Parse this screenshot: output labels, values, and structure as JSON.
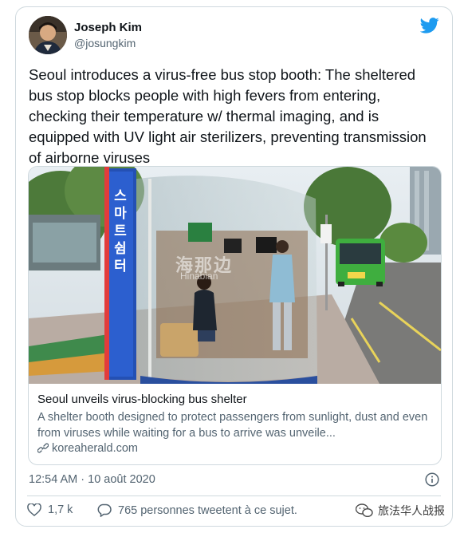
{
  "author": {
    "name": "Joseph Kim",
    "handle": "@josungkim"
  },
  "tweet": {
    "text": "Seoul introduces a virus-free bus stop booth: The sheltered bus stop blocks people with high fevers from entering, checking their temperature w/ thermal imaging, and is equipped with UV light air sterilizers, preventing transmission of airborne viruses",
    "timestamp": "12:54 AM · 10 août 2020"
  },
  "link_card": {
    "image": {
      "booth_sign": "스마트쉼터",
      "watermark_cn": "海那边",
      "watermark_en": "Hinabian",
      "bus_color": "#3fae3f"
    },
    "title": "Seoul unveils virus-blocking bus shelter",
    "description": "A shelter booth designed to protect passengers from sunlight, dust and even from viruses while waiting for a bus to arrive was unveile...",
    "domain": "koreaherald.com"
  },
  "actions": {
    "likes": "1,7 k",
    "replies_text": "765 personnes tweetent à ce sujet."
  },
  "footer_watermark": "旅法华人战报",
  "colors": {
    "twitter_blue": "#1d9bf0",
    "secondary_text": "#536471",
    "border": "#cfd9de"
  }
}
